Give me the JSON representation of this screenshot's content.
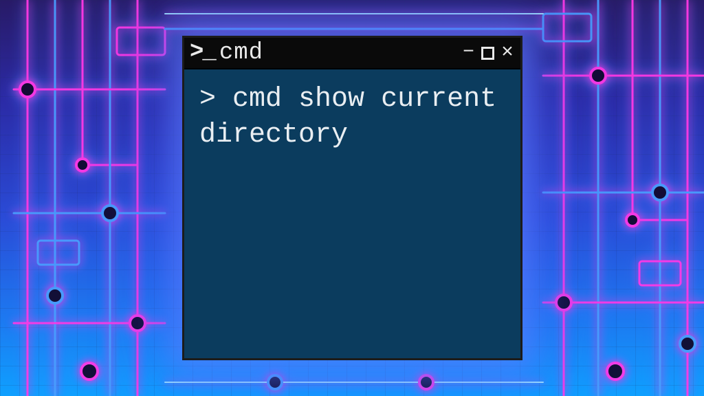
{
  "window": {
    "title": "cmd",
    "prompt_glyph": ">_",
    "controls": {
      "min": "−",
      "max": "",
      "close": "×"
    }
  },
  "terminal": {
    "prompt": ">",
    "command": "cmd show current directory"
  },
  "colors": {
    "window_bg": "#0b3c5e",
    "titlebar_bg": "#0a0a0a",
    "text": "#e9eef2",
    "neon_pink": "#ff39e6",
    "neon_blue": "#4a9dff"
  }
}
